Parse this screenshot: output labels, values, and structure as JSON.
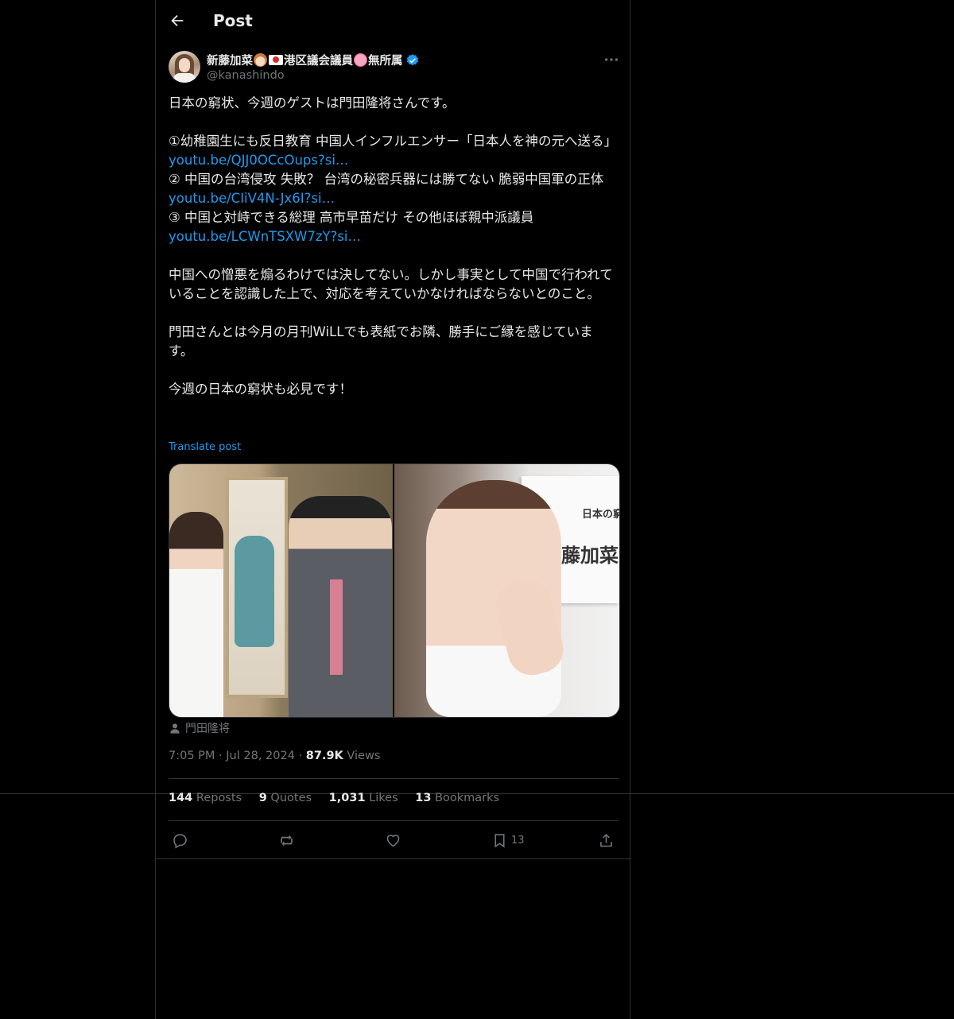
{
  "header": {
    "title": "Post"
  },
  "author": {
    "name": "新藤加菜",
    "name_mid": "港区議会議員",
    "name_end": "無所属",
    "handle": "@kanashindo"
  },
  "post": {
    "paragraphs": [
      "日本の窮状、今週のゲストは門田隆将さんです。",
      "",
      "①幼稚園生にも反日教育 中国人インフルエンサー「日本人を神の元へ送る」",
      "LINK:youtu.be/QJJ0OCcOups?si…",
      "② 中国の台湾侵攻 失敗？ 台湾の秘密兵器には勝てない 脆弱中国軍の正体",
      "LINK:youtu.be/CIiV4N-Jx6I?si…",
      "③ 中国と対峙できる総理 高市早苗だけ その他ほぼ親中派議員",
      "LINK:youtu.be/LCWnTSXW7zY?si…",
      "",
      "中国への憎悪を煽るわけでは決してない。しかし事実として中国で行われていることを認識した上で、対応を考えていかなければならないとのこと。",
      "",
      "門田さんとは今月の月刊WiLLでも表紙でお隣、勝手にご縁を感じています。",
      "",
      "今週の日本の窮状も必見です！"
    ],
    "translate_label": "Translate post",
    "media_card": {
      "small": "日本の窮",
      "big": "新藤加菜"
    },
    "tagged_person": "門田隆将",
    "time": "7:05 PM",
    "date": "Jul 28, 2024",
    "views_count": "87.9K",
    "views_label": "Views"
  },
  "stats": {
    "reposts_count": "144",
    "reposts_label": "Reposts",
    "quotes_count": "9",
    "quotes_label": "Quotes",
    "likes_count": "1,031",
    "likes_label": "Likes",
    "bookmarks_count": "13",
    "bookmarks_label": "Bookmarks"
  },
  "actions": {
    "bookmark_count": "13"
  },
  "colors": {
    "background": "#000000",
    "text": "#e7e9ea",
    "muted": "#71767b",
    "link": "#1d9bf0",
    "border": "#2f3336"
  }
}
